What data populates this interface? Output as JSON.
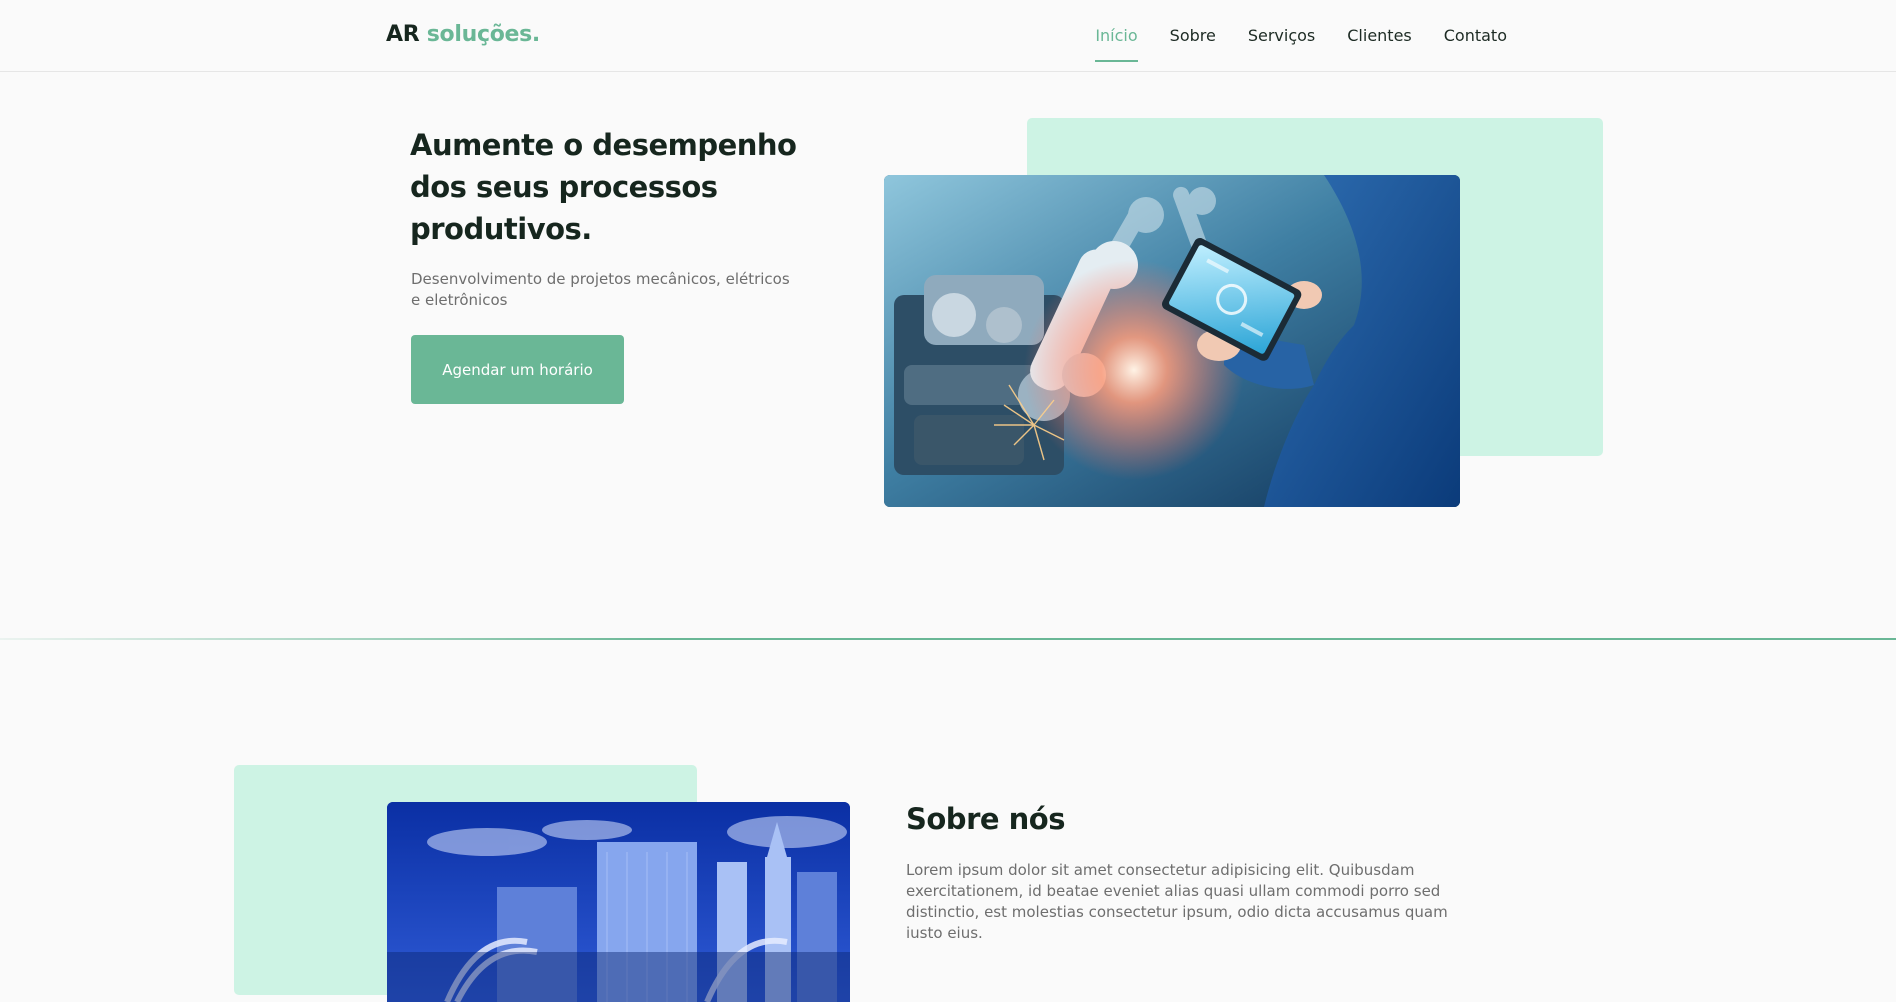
{
  "brand": {
    "part1": "AR",
    "part2": "soluções."
  },
  "nav": {
    "items": [
      {
        "label": "Início",
        "active": true
      },
      {
        "label": "Sobre",
        "active": false
      },
      {
        "label": "Serviços",
        "active": false
      },
      {
        "label": "Clientes",
        "active": false
      },
      {
        "label": "Contato",
        "active": false
      }
    ]
  },
  "hero": {
    "title": "Aumente o desempenho dos seus processos produtivos.",
    "subtitle": "Desenvolvimento de projetos mecânicos, elétricos e eletrônicos",
    "cta_label": "Agendar um horário",
    "image_icon": "industrial-robot-tablet-image"
  },
  "about": {
    "title": "Sobre nós",
    "text": "Lorem ipsum dolor sit amet consectetur adipisicing elit. Quibusdam exercitationem, id beatae eveniet alias quasi ullam commodi porro sed distinctio, est molestias consectetur ipsum, odio dicta accusamus quam iusto eius.",
    "image_icon": "city-skyline-image"
  },
  "colors": {
    "accent": "#6ab796",
    "accent_light": "#cdf3e4",
    "heading": "#16261e",
    "body_text": "#6e6e6e",
    "background": "#fafafa"
  }
}
